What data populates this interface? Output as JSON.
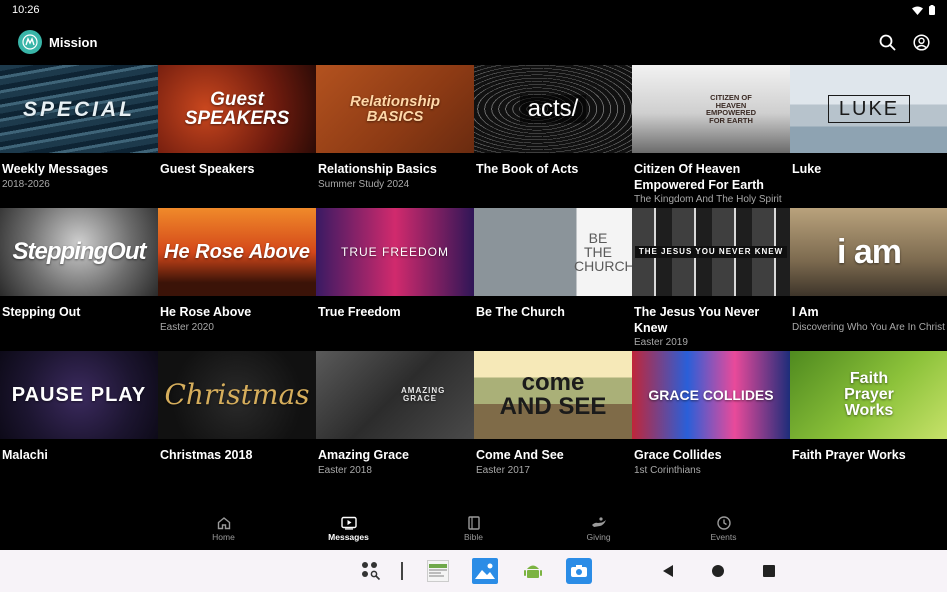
{
  "status_bar": {
    "time": "10:26"
  },
  "app_bar": {
    "title": "Mission",
    "logo_letter": "M"
  },
  "tiles": [
    {
      "title": "Weekly Messages",
      "subtitle": "2018-2026",
      "art": "SPECIAL"
    },
    {
      "title": "Guest Speakers",
      "subtitle": "",
      "art": "Guest SPEAKERS"
    },
    {
      "title": "Relationship Basics",
      "subtitle": "Summer Study 2024",
      "art": "Relationship BASICS"
    },
    {
      "title": "The Book of Acts",
      "subtitle": "",
      "art": "acts/"
    },
    {
      "title": "Citizen Of Heaven Empowered For Earth",
      "subtitle": "The Kingdom And The Holy Spirit",
      "art": "CITIZEN OF HEAVEN EMPOWERED FOR EARTH"
    },
    {
      "title": "Luke",
      "subtitle": "",
      "art": "LUKE"
    },
    {
      "title": "Stepping Out",
      "subtitle": "",
      "art": "SteppingOut"
    },
    {
      "title": "He Rose Above",
      "subtitle": "Easter 2020",
      "art": "He Rose Above"
    },
    {
      "title": "True Freedom",
      "subtitle": "",
      "art": "TRUE FREEDOM"
    },
    {
      "title": "Be The Church",
      "subtitle": "",
      "art": "BE THE CHURCH"
    },
    {
      "title": "The Jesus You Never Knew",
      "subtitle": "Easter 2019",
      "art": "THE JESUS YOU NEVER KNEW"
    },
    {
      "title": "I Am",
      "subtitle": "Discovering Who You Are In Christ",
      "art": "i am"
    },
    {
      "title": "Malachi",
      "subtitle": "",
      "art": "PAUSE PLAY"
    },
    {
      "title": "Christmas 2018",
      "subtitle": "",
      "art": "Christmas"
    },
    {
      "title": "Amazing Grace",
      "subtitle": "Easter 2018",
      "art": "AMAZING GRACE"
    },
    {
      "title": "Come And See",
      "subtitle": "Easter 2017",
      "art": "come AND SEE"
    },
    {
      "title": "Grace Collides",
      "subtitle": "1st Corinthians",
      "art": "GRACE COLLIDES"
    },
    {
      "title": "Faith Prayer Works",
      "subtitle": "",
      "art": "Faith Prayer Works"
    }
  ],
  "bottom_nav": [
    {
      "label": "Home",
      "icon": "home-icon",
      "active": false
    },
    {
      "label": "Messages",
      "icon": "play-icon",
      "active": true
    },
    {
      "label": "Bible",
      "icon": "book-icon",
      "active": false
    },
    {
      "label": "Giving",
      "icon": "giving-icon",
      "active": false
    },
    {
      "label": "Events",
      "icon": "clock-icon",
      "active": false
    }
  ],
  "colors": {
    "accent": "#39b5a8",
    "background": "#000000",
    "muted_text": "#a9a9a9",
    "system_bar": "#f7f3f8"
  }
}
